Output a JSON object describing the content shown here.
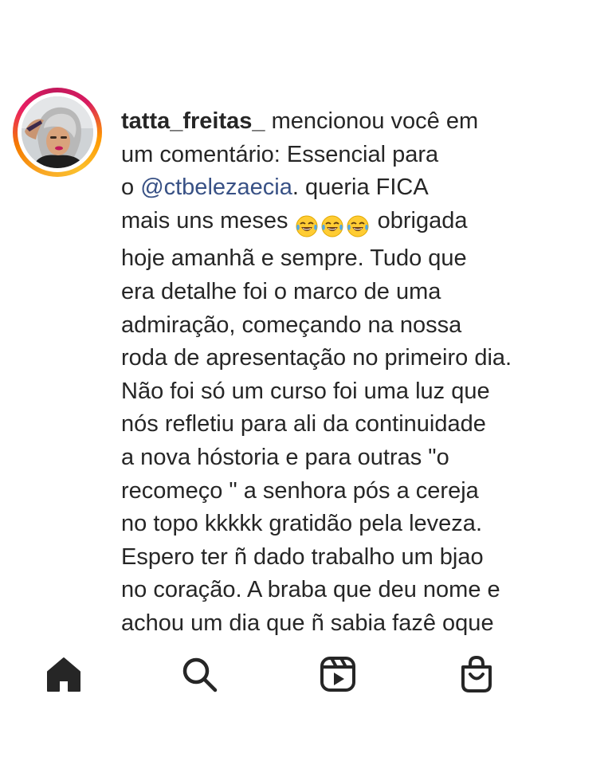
{
  "comment": {
    "username": "tatta_freitas_",
    "line1_rest": " mencionou você em",
    "line2": "um comentário: Essencial para",
    "line3_prefix": "o ",
    "mention": "@ctbelezaecia",
    "line3_rest": ". queria  FICA",
    "line4_prefix": "mais uns meses ",
    "line4_rest": " obrigada",
    "line5": "hoje amanhã e sempre. Tudo que",
    "line6": "era detalhe foi o marco de uma",
    "line7": "admiração, começando na nossa",
    "line8": "roda de apresentação no primeiro dia.",
    "line9": "Não foi só um curso foi uma luz que",
    "line10": "nós refletiu para ali da continuidade",
    "line11": "a nova hóstoria e para outras \"o",
    "line12": "recomeço \" a senhora pós a cereja",
    "line13": "no topo kkkkk gratidão pela leveza.",
    "line14": "Espero ter ñ dado trabalho um bjao",
    "line15": "no coração.  A braba que deu nome e",
    "line16": "achou um dia que ñ sabia fazê oque",
    "emojis": [
      "face-with-tears-of-joy-icon",
      "face-with-tears-of-joy-icon",
      "face-with-tears-of-joy-icon"
    ]
  },
  "colors": {
    "text": "#262626",
    "mention": "#385185",
    "icon": "#262626",
    "ring_start": "#f9a825",
    "ring_end": "#d81b60"
  },
  "nav": {
    "items": [
      "home-icon",
      "search-icon",
      "reels-icon",
      "shop-icon"
    ],
    "active": "home-icon"
  }
}
